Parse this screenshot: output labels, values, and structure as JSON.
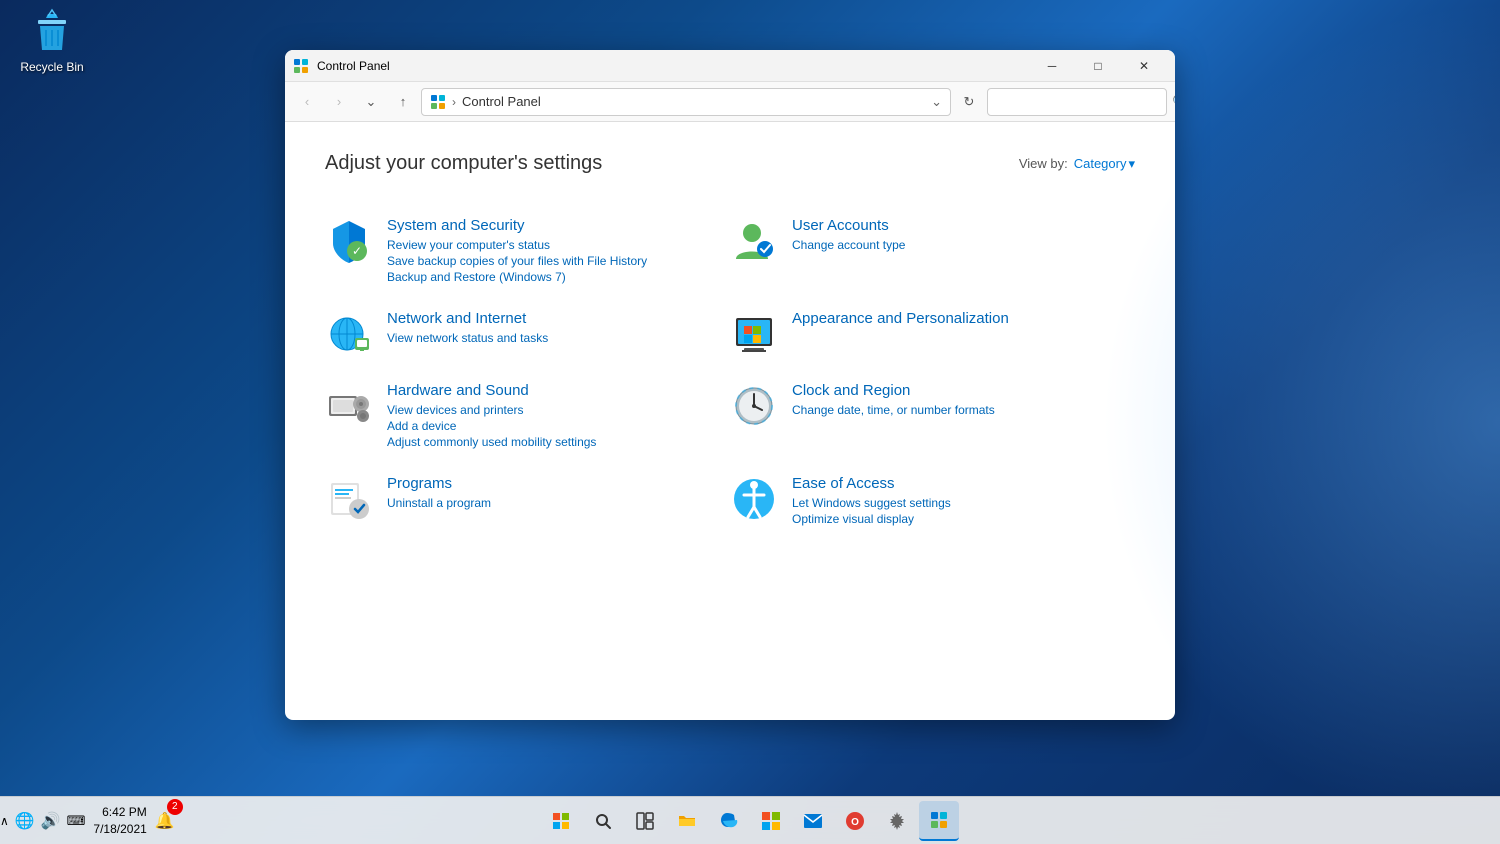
{
  "desktop": {
    "recycle_bin_label": "Recycle Bin"
  },
  "window": {
    "title": "Control Panel",
    "page_title": "Adjust your computer's settings",
    "view_by_label": "View by:",
    "view_by_value": "Category",
    "address_path": "Control Panel",
    "search_placeholder": ""
  },
  "nav_buttons": {
    "back": "‹",
    "forward": "›",
    "recent": "⌄",
    "up": "↑",
    "refresh": "↻",
    "search_icon": "🔍"
  },
  "window_controls": {
    "minimize": "─",
    "maximize": "□",
    "close": "✕"
  },
  "categories": [
    {
      "id": "system-security",
      "title": "System and Security",
      "links": [
        "Review your computer's status",
        "Save backup copies of your files with File History",
        "Backup and Restore (Windows 7)"
      ]
    },
    {
      "id": "user-accounts",
      "title": "User Accounts",
      "links": [
        "Change account type"
      ]
    },
    {
      "id": "network-internet",
      "title": "Network and Internet",
      "links": [
        "View network status and tasks"
      ]
    },
    {
      "id": "appearance",
      "title": "Appearance and Personalization",
      "links": []
    },
    {
      "id": "hardware-sound",
      "title": "Hardware and Sound",
      "links": [
        "View devices and printers",
        "Add a device",
        "Adjust commonly used mobility settings"
      ]
    },
    {
      "id": "clock-region",
      "title": "Clock and Region",
      "links": [
        "Change date, time, or number formats"
      ]
    },
    {
      "id": "programs",
      "title": "Programs",
      "links": [
        "Uninstall a program"
      ]
    },
    {
      "id": "ease-access",
      "title": "Ease of Access",
      "links": [
        "Let Windows suggest settings",
        "Optimize visual display"
      ]
    }
  ],
  "taskbar": {
    "time": "6:42 PM",
    "date": "7/18/2021",
    "notification_count": "2"
  }
}
